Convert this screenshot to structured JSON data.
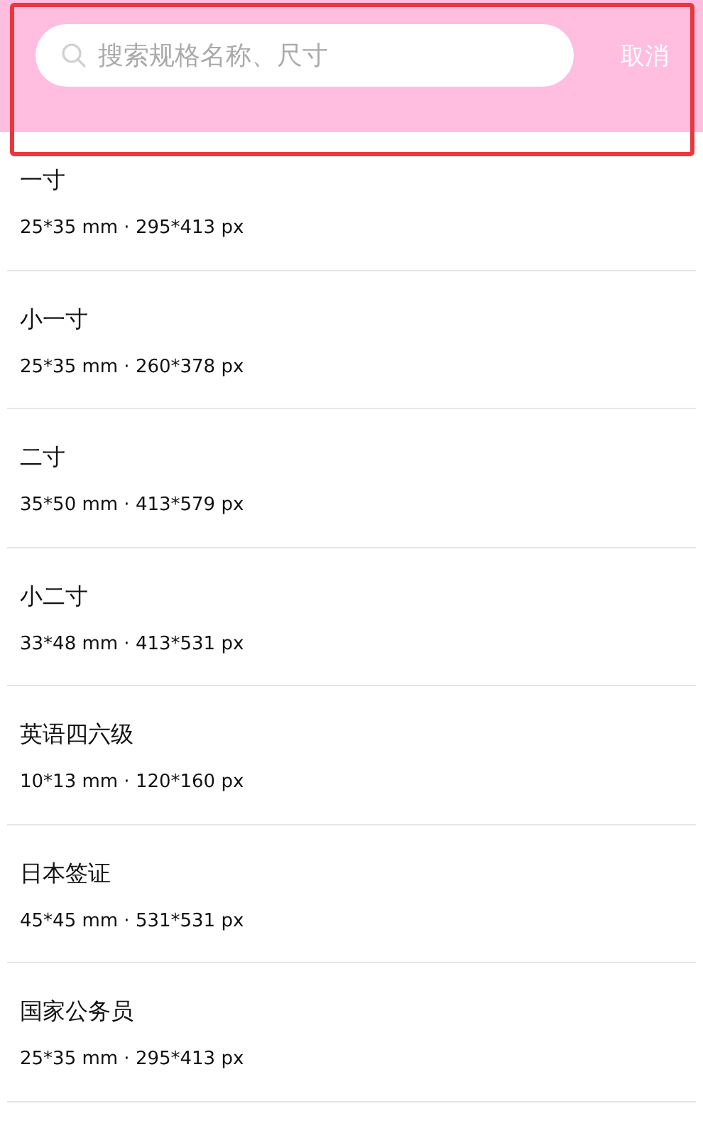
{
  "search": {
    "placeholder": "搜索规格名称、尺寸"
  },
  "cancel": "取消",
  "specs": [
    {
      "name": "一寸",
      "size": "25*35 mm · 295*413 px"
    },
    {
      "name": "小一寸",
      "size": "25*35 mm · 260*378 px"
    },
    {
      "name": "二寸",
      "size": "35*50 mm · 413*579 px"
    },
    {
      "name": "小二寸",
      "size": "33*48 mm · 413*531 px"
    },
    {
      "name": "英语四六级",
      "size": "10*13 mm · 120*160 px"
    },
    {
      "name": "日本签证",
      "size": "45*45 mm · 531*531 px"
    },
    {
      "name": "国家公务员",
      "size": "25*35 mm · 295*413 px"
    }
  ]
}
